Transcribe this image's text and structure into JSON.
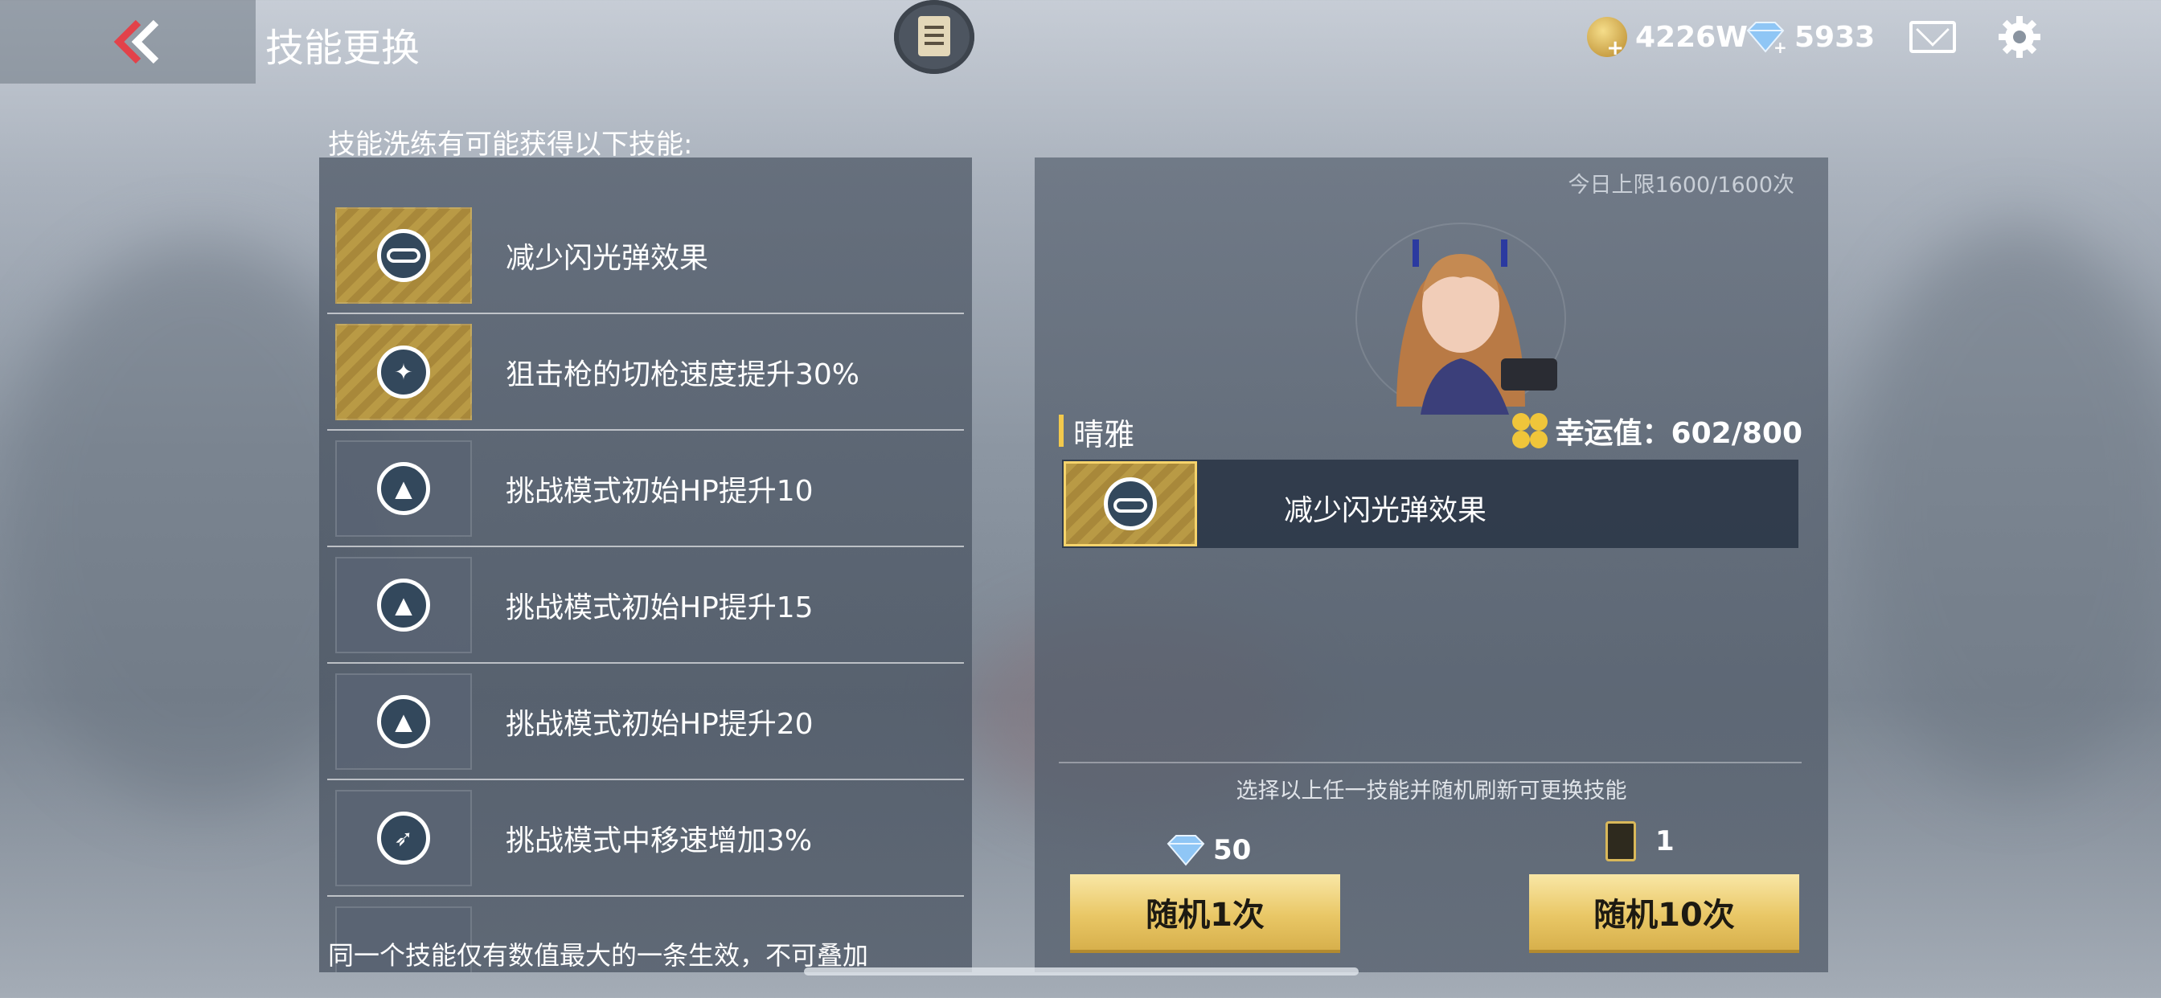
{
  "header": {
    "title": "技能更换",
    "coins": "4226W",
    "gems": "5933"
  },
  "skills_panel": {
    "caption": "技能洗练有可能获得以下技能:",
    "items": [
      {
        "label": "减少闪光弹效果",
        "icon": "goggles-icon",
        "highlight": true
      },
      {
        "label": "狙击枪的切枪速度提升30%",
        "icon": "sniper-emblem-icon",
        "highlight": true
      },
      {
        "label": "挑战模式初始HP提升10",
        "icon": "triangle-emblem-icon",
        "highlight": false
      },
      {
        "label": "挑战模式初始HP提升15",
        "icon": "triangle-emblem-icon",
        "highlight": false
      },
      {
        "label": "挑战模式初始HP提升20",
        "icon": "triangle-emblem-icon",
        "highlight": false
      },
      {
        "label": "挑战模式中移速增加3%",
        "icon": "running-man-icon",
        "highlight": false
      }
    ],
    "footnote": "同一个技能仅有数值最大的一条生效，不可叠加"
  },
  "right_panel": {
    "daily_limit": "今日上限1600/1600次",
    "character_name": "晴雅",
    "luck_label": "幸运值：602/800",
    "current_skill": "减少闪光弹效果",
    "hint": "选择以上任一技能并随机刷新可更换技能",
    "cost_gems": "50",
    "cost_tickets": "1",
    "btn_once": "随机1次",
    "btn_ten": "随机10次"
  },
  "colors": {
    "gold_button": "#e9c766",
    "accent_yellow": "#f2c94c"
  }
}
